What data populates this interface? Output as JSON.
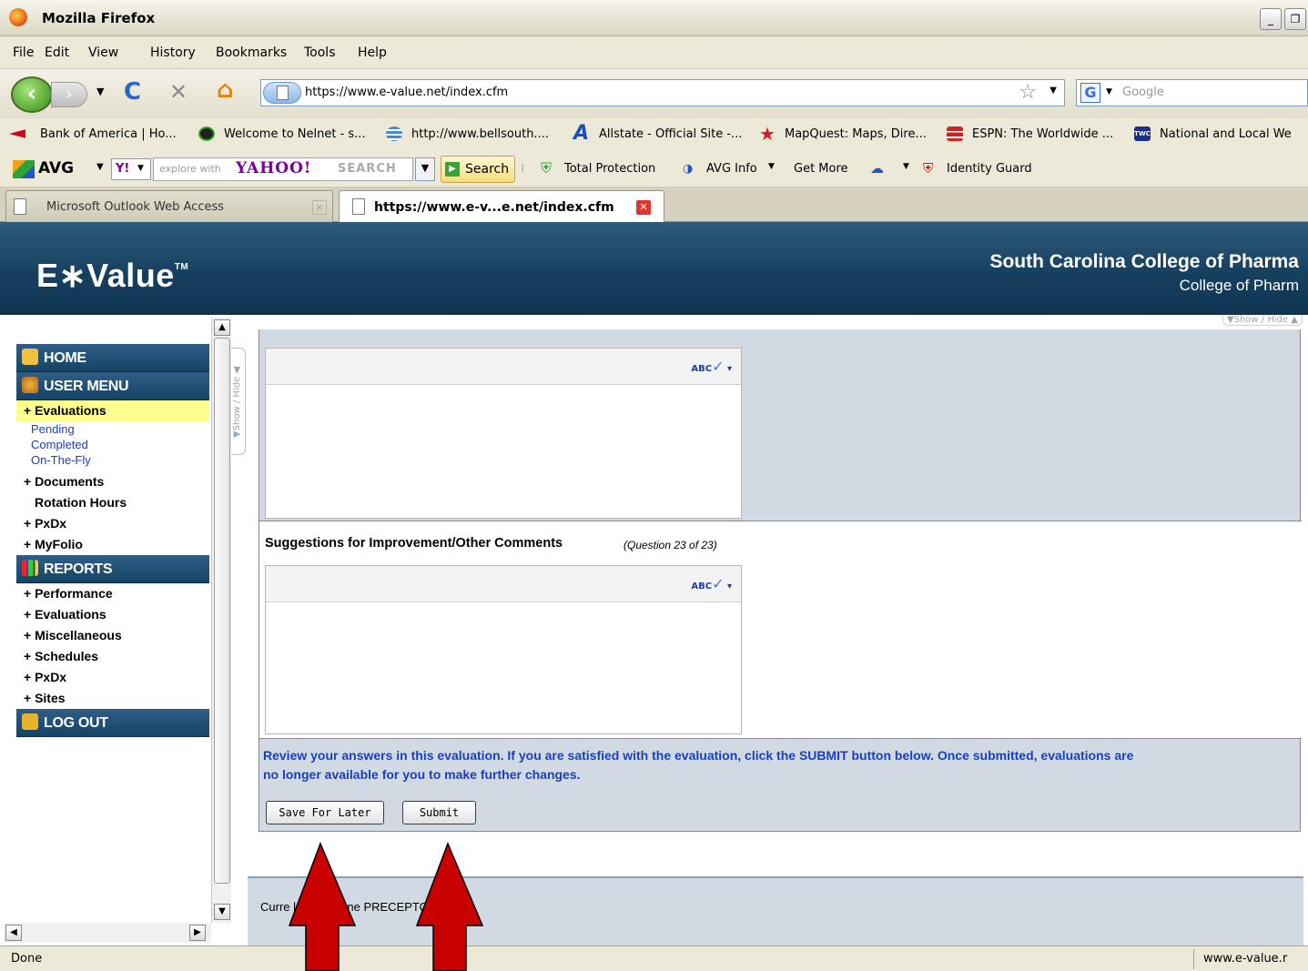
{
  "window": {
    "title": "Mozilla Firefox",
    "minimize_glyph": "_",
    "restore_glyph": "❐"
  },
  "menu": [
    "File",
    "Edit",
    "View",
    "History",
    "Bookmarks",
    "Tools",
    "Help"
  ],
  "navigation": {
    "back_icon": "back-arrow-icon",
    "reload_glyph": "C",
    "stop_glyph": "✕",
    "home_glyph": "⌂",
    "url": "https://www.e-value.net/index.cfm",
    "search_engine_glyph": "G",
    "search_placeholder": "Google"
  },
  "bookmarks": [
    {
      "label": "Bank of America | Ho...",
      "icon": "bank-of-america-icon",
      "color": "#d4001a"
    },
    {
      "label": "Welcome to Nelnet - s...",
      "icon": "nelnet-icon",
      "color": "#2a7a14"
    },
    {
      "label": "http://www.bellsouth....",
      "icon": "att-globe-icon",
      "color": "#3d8ae0"
    },
    {
      "label": "Allstate - Official Site -...",
      "icon": "allstate-icon",
      "color": "#1a4fbf"
    },
    {
      "label": "MapQuest: Maps, Dire...",
      "icon": "mapquest-star-icon",
      "color": "#d42020"
    },
    {
      "label": "ESPN: The Worldwide ...",
      "icon": "espn-icon",
      "color": "#d42020"
    },
    {
      "label": "National and Local We",
      "icon": "twc-icon",
      "color": "#1a2f8a",
      "icon_text": "TWC"
    }
  ],
  "avg_toolbar": {
    "brand": "AVG",
    "yahoo_badge": "Y!",
    "search_hint": "explore with",
    "search_brand": "YAHOO!",
    "search_word": "SEARCH",
    "search_button": "Search",
    "total_protection": "Total Protection",
    "avg_info": "AVG Info",
    "get_more": "Get More",
    "identity_guard": "Identity Guard"
  },
  "tabs": [
    {
      "label": "Microsoft Outlook Web Access",
      "active": false
    },
    {
      "label": "https://www.e-v...e.net/index.cfm",
      "active": true
    }
  ],
  "header": {
    "logo": "E∗Value",
    "logo_tm": "TM",
    "institution": "South Carolina College of Pharma",
    "institution_sub": "College of Pharm"
  },
  "sidebar": {
    "home": "HOME",
    "user_menu": "USER MENU",
    "evaluations": "+ Evaluations",
    "eval_sub": [
      "Pending",
      "Completed",
      "On-The-Fly"
    ],
    "documents": "+ Documents",
    "rotation_hours": "Rotation Hours",
    "pxdx": "+ PxDx",
    "myfolio": "+ MyFolio",
    "reports": "REPORTS",
    "report_items": [
      "+ Performance",
      "+ Evaluations",
      "+ Miscellaneous",
      "+ Schedules",
      "+ PxDx",
      "+ Sites"
    ],
    "logout": "LOG OUT",
    "show_hide": "▼Show / Hide ◀"
  },
  "content": {
    "show_hide": "▼Show / Hide ▲",
    "spell_label": "ABC",
    "question_title": "Suggestions for Improvement/Other Comments",
    "question_number": "(Question 23 of 23)",
    "review_text_1": "Review your answers in this evaluation. If you are satisfied with the evaluation, click the SUBMIT button below. Once submitted, evaluations are",
    "review_text_2": "no longer available for you to make further changes.",
    "save_button": "Save For Later",
    "submit_button": "Submit"
  },
  "footer": {
    "evaluating_text": "Curre      luating: Jane          PRECEPTOR"
  },
  "status": {
    "left": "Done",
    "right": "www.e-value.r"
  },
  "colors": {
    "header_blue": "#17405f",
    "arrow_red": "#c80000",
    "active_item": "#ffff90"
  }
}
